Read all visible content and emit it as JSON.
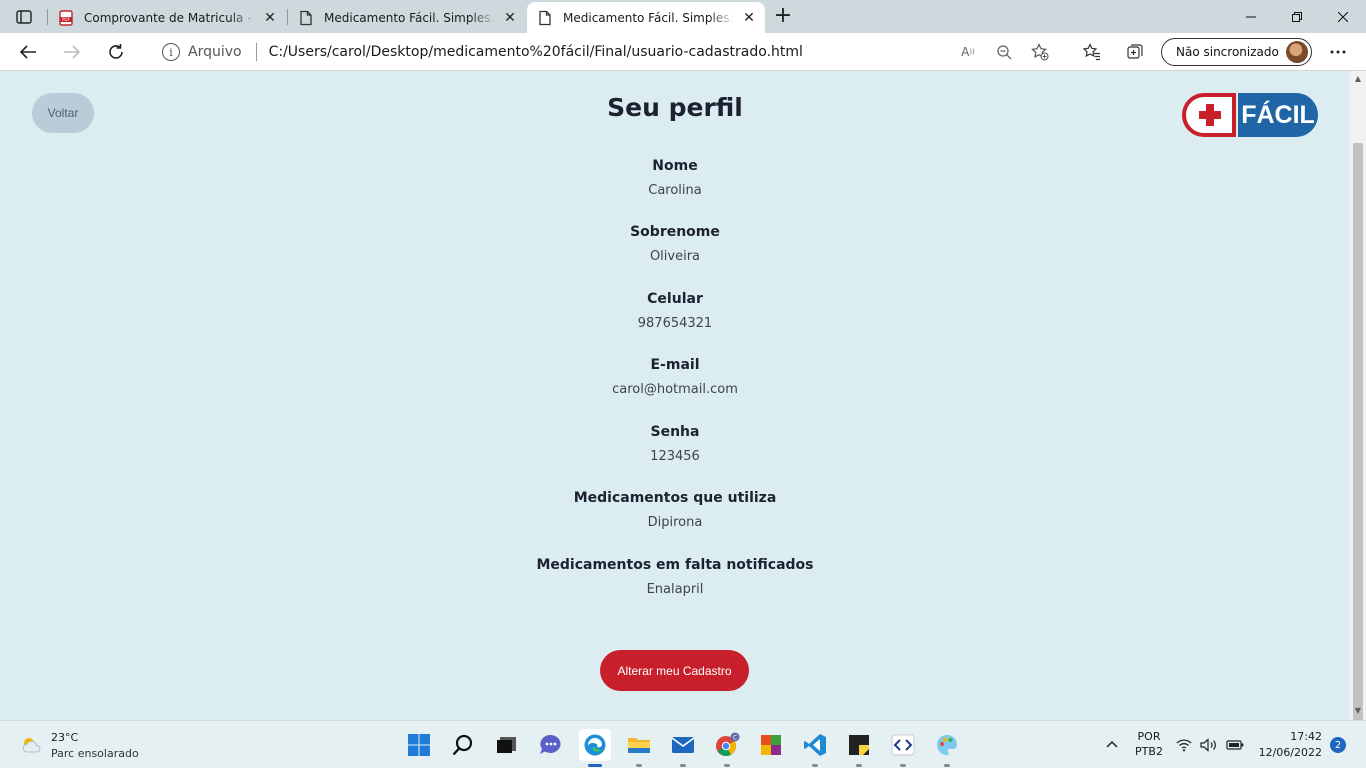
{
  "browser": {
    "tabs": [
      {
        "title": "Comprovante de Matricula - Carol",
        "icon": "pdf-icon"
      },
      {
        "title": "Medicamento Fácil. Simples. Rápido",
        "icon": "page-icon"
      },
      {
        "title": "Medicamento Fácil. Simples. Rápido",
        "icon": "page-icon",
        "active": true
      }
    ],
    "address": {
      "label": "Arquivo",
      "url": "C:/Users/carol/Desktop/medicamento%20fácil/Final/usuario-cadastrado.html"
    },
    "sync_label": "Não sincronizado"
  },
  "page": {
    "back_label": "Voltar",
    "title": "Seu perfil",
    "logo_text": "FÁCIL",
    "fields": [
      {
        "label": "Nome",
        "value": "Carolina"
      },
      {
        "label": "Sobrenome",
        "value": "Oliveira"
      },
      {
        "label": "Celular",
        "value": "987654321"
      },
      {
        "label": "E-mail",
        "value": "carol@hotmail.com"
      },
      {
        "label": "Senha",
        "value": "123456"
      },
      {
        "label": "Medicamentos que utiliza",
        "value": "Dipirona"
      },
      {
        "label": "Medicamentos em falta notificados",
        "value": "Enalapril"
      }
    ],
    "edit_label": "Alterar meu Cadastro"
  },
  "colors": {
    "page_bg": "#dcedf1",
    "primary_red": "#c8202b",
    "logo_blue": "#2066a6",
    "back_button_bg": "#b9cdd8"
  },
  "taskbar": {
    "weather_temp": "23°C",
    "weather_desc": "Parc ensolarado",
    "lang_1": "POR",
    "lang_2": "PTB2",
    "time": "17:42",
    "date": "12/06/2022",
    "notifications": "2",
    "apps": [
      "windows-start-icon",
      "search-icon",
      "task-view-icon",
      "chat-icon",
      "edge-icon",
      "file-explorer-icon",
      "mail-icon",
      "chrome-icon",
      "office-icon",
      "vscode-icon",
      "sticky-notes-icon",
      "dev-tools-icon",
      "paint-icon"
    ]
  }
}
